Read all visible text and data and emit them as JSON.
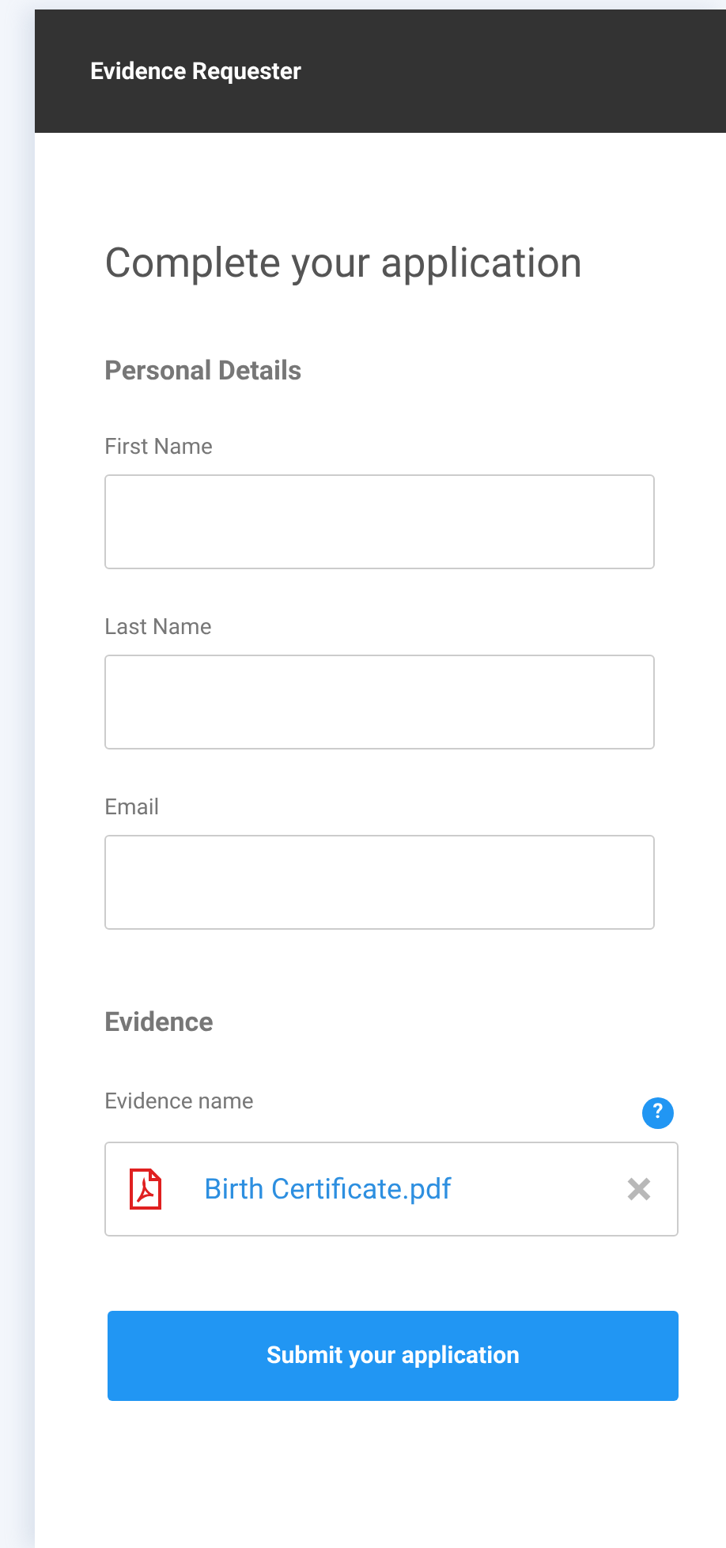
{
  "header": {
    "title": "Evidence Requester"
  },
  "heading": "Complete your application",
  "personal": {
    "title": "Personal Details",
    "fields": [
      {
        "label": "First Name"
      },
      {
        "label": "Last Name"
      },
      {
        "label": "Email"
      }
    ]
  },
  "evidence": {
    "title": "Evidence",
    "label": "Evidence name",
    "help": "?",
    "file": "Birth Certificate.pdf"
  },
  "submit": "Submit your application"
}
